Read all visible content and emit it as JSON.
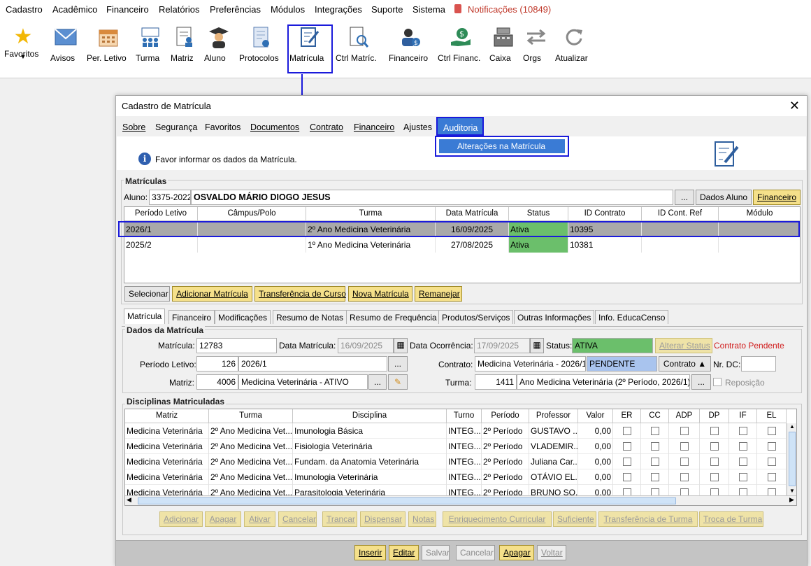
{
  "menubar": {
    "items": [
      "Cadastro",
      "Acadêmico",
      "Financeiro",
      "Relatórios",
      "Preferências",
      "Módulos",
      "Integrações",
      "Suporte",
      "Sistema"
    ],
    "notifications": "Notificações (10849)"
  },
  "toolbar": {
    "items": [
      "Favoritos",
      "Avisos",
      "Per. Letivo",
      "Turma",
      "Matriz",
      "Aluno",
      "Protocolos",
      "Matrícula",
      "Ctrl Matríc.",
      "Financeiro",
      "Ctrl Financ.",
      "Caixa",
      "Orgs",
      "Atualizar"
    ]
  },
  "dialog": {
    "title": "Cadastro de Matrícula",
    "menu": [
      "Sobre",
      "Segurança",
      "Favoritos",
      "Documentos",
      "Contrato",
      "Financeiro",
      "Ajustes",
      "Auditoria"
    ],
    "dropdown_item": "Alterações na Matrícula",
    "info_text": "Favor informar os dados da Matrícula.",
    "matriculas": {
      "group_title": "Matrículas",
      "aluno_label": "Aluno:",
      "aluno_code": "3375-2022",
      "aluno_name": "OSVALDO MÁRIO DIOGO JESUS",
      "ellipsis": "...",
      "dados_aluno": "Dados Aluno",
      "financeiro": "Financeiro",
      "columns": [
        "Período Letivo",
        "Câmpus/Polo",
        "Turma",
        "Data Matrícula",
        "Status",
        "ID Contrato",
        "ID Cont. Ref",
        "Módulo"
      ],
      "rows": [
        [
          "2026/1",
          "",
          "2º Ano Medicina Veterinária",
          "16/09/2025",
          "Ativa",
          "10395",
          "",
          ""
        ],
        [
          "2025/2",
          "",
          "1º  Ano Medicina Veterinária",
          "27/08/2025",
          "Ativa",
          "10381",
          "",
          ""
        ]
      ],
      "buttons": [
        "Selecionar",
        "Adicionar Matrícula",
        "Transferência de Curso",
        "Nova Matrícula",
        "Remanejar"
      ]
    },
    "tabs": [
      "Matrícula",
      "Financeiro",
      "Modificações",
      "Resumo de Notas",
      "Resumo de Frequência",
      "Produtos/Serviços",
      "Outras Informações",
      "Info. EducaCenso"
    ],
    "dados": {
      "group_title": "Dados da Matrícula",
      "matricula_label": "Matrícula:",
      "matricula": "12783",
      "data_matricula_label": "Data Matrícula:",
      "data_matricula": "16/09/2025",
      "data_ocorrencia_label": "Data Ocorrência:",
      "data_ocorrencia": "17/09/2025",
      "status_label": "Status:",
      "status": "ATIVA",
      "alterar_status": "Alterar Status",
      "contrato_pendente": "Contrato Pendente",
      "periodo_label": "Período Letivo:",
      "periodo_code": "126",
      "periodo": "2026/1",
      "contrato_label": "Contrato:",
      "contrato": "Medicina Veterinária - 2026/1",
      "contrato_status": "PENDENTE",
      "contrato_btn": "Contrato ▲",
      "nr_dc_label": "Nr. DC:",
      "matriz_label": "Matriz:",
      "matriz_code": "4006",
      "matriz": "Medicina Veterinária - ATIVO",
      "turma_label": "Turma:",
      "turma_code": "1411",
      "turma": "Ano Medicina Veterinária (2º Período, 2026/1)",
      "reposicao": "Reposição"
    },
    "disciplinas": {
      "group_title": "Disciplinas Matriculadas",
      "columns": [
        "Matriz",
        "Turma",
        "Disciplina",
        "Turno",
        "Período",
        "Professor",
        "Valor",
        "ER",
        "CC",
        "ADP",
        "DP",
        "IF",
        "EL"
      ],
      "rows": [
        [
          "Medicina Veterinária",
          "2º Ano Medicina Vet...",
          "Imunologia Básica",
          "INTEG...",
          "2º Período",
          "GUSTAVO ...",
          "0,00"
        ],
        [
          "Medicina Veterinária",
          "2º Ano Medicina Vet...",
          "Fisiologia Veterinária",
          "INTEG...",
          "2º Período",
          "VLADEMIR...",
          "0,00"
        ],
        [
          "Medicina Veterinária",
          "2º Ano Medicina Vet...",
          "Fundam. da Anatomia Veterinária",
          "INTEG...",
          "2º Período",
          "Juliana Car...",
          "0,00"
        ],
        [
          "Medicina Veterinária",
          "2º Ano Medicina Vet...",
          "Imunologia Veterinária",
          "INTEG...",
          "2º Período",
          "OTÁVIO EL...",
          "0,00"
        ],
        [
          "Medicina Veterinária",
          "2º Ano Medicina Vet...",
          "Parasitologia Veterinária",
          "INTEG...",
          "2º Período",
          "BRUNO SO...",
          "0,00"
        ]
      ],
      "buttons": [
        "Adicionar",
        "Apagar",
        "Ativar",
        "Cancelar",
        "Trancar",
        "Dispensar",
        "Notas",
        "Enriquecimento Curricular",
        "Suficiente",
        "Transferência de Turma",
        "Troca de Turma"
      ]
    },
    "footer_buttons": [
      "Inserir",
      "Editar",
      "Salvar",
      "Cancelar",
      "Apagar",
      "Voltar"
    ]
  }
}
